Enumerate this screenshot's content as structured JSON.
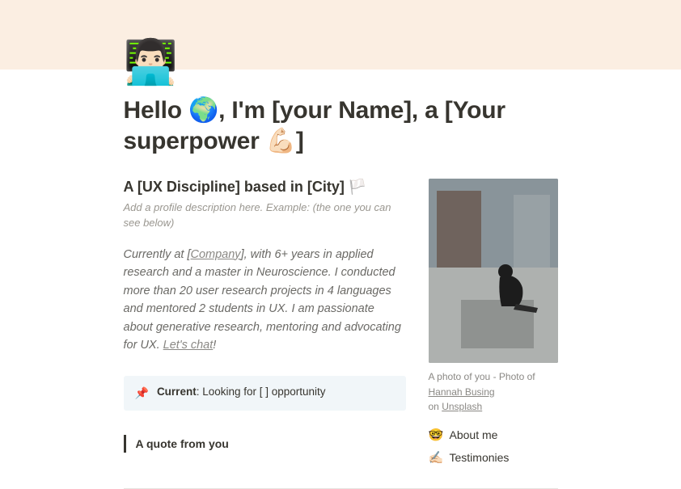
{
  "icon": "👨🏻‍💻",
  "title": "Hello 🌍, I'm [your Name], a [Your superpower 💪🏻]",
  "left": {
    "subheading": "A [UX Discipline] based in [City] 🏳️",
    "hint": "Add a profile description here. Example: (the one you can see below)",
    "bio_pre": "Currently at [",
    "bio_company": "Company",
    "bio_mid": "], with 6+ years in applied research and a master in Neuroscience. I conducted more than 20 user research projects in 4 languages and mentored 2 students in UX. I am passionate about generative research, mentoring and advocating for UX. ",
    "bio_chat": "Let's chat",
    "bio_post": "!",
    "callout_icon": "📌",
    "callout_bold": "Current",
    "callout_rest": ": Looking for [ ] opportunity",
    "quote": "A quote from you"
  },
  "right": {
    "caption_pre": "A photo of you - Photo of ",
    "caption_link1": "Hannah Busing",
    "caption_mid": " on ",
    "caption_link2": "Unsplash",
    "links": [
      {
        "emoji": "🤓",
        "label": "About me"
      },
      {
        "emoji": "✍🏻",
        "label": "Testimonies"
      }
    ]
  }
}
